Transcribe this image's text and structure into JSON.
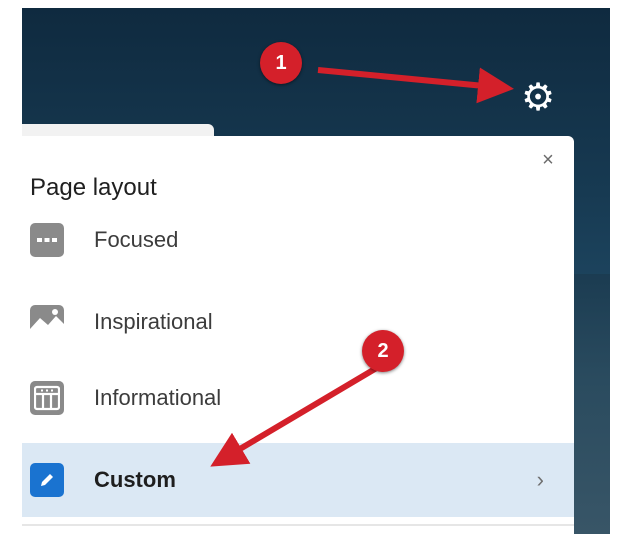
{
  "panel": {
    "title": "Page layout",
    "close_glyph": "×",
    "options": [
      {
        "label": "Focused",
        "icon": "focused-layout-icon"
      },
      {
        "label": "Inspirational",
        "icon": "inspirational-layout-icon"
      },
      {
        "label": "Informational",
        "icon": "informational-layout-icon"
      },
      {
        "label": "Custom",
        "icon": "pencil-icon",
        "selected": true
      }
    ],
    "chevron": "›"
  },
  "annotations": {
    "step1": "1",
    "step2": "2",
    "color": "#d4202a"
  },
  "header": {
    "gear_glyph": "⚙"
  },
  "colors": {
    "accent": "#1a73d0",
    "selected_row": "#dbe8f4"
  }
}
